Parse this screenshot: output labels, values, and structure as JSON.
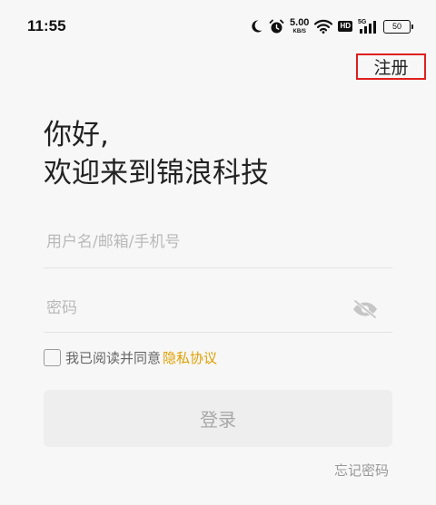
{
  "status_bar": {
    "time": "11:55",
    "net_speed_value": "5.00",
    "net_speed_unit": "KB/S",
    "hd_label": "HD",
    "network_type": "5G",
    "battery_level": "50",
    "icons": [
      "moon-icon",
      "alarm-icon",
      "wifi-icon",
      "signal-icon",
      "battery-icon"
    ]
  },
  "header": {
    "register_label": "注册"
  },
  "greeting": {
    "line1": "你好,",
    "line2": "欢迎来到锦浪科技"
  },
  "form": {
    "username_placeholder": "用户名/邮箱/手机号",
    "username_value": "",
    "password_placeholder": "密码",
    "password_value": "",
    "agree_prefix": "我已阅读并同意",
    "privacy_label": "隐私协议",
    "agree_checked": false,
    "login_label": "登录",
    "forgot_label": "忘记密码"
  },
  "colors": {
    "accent_link": "#e0a000",
    "highlight_border": "#e01e1e",
    "background": "#f7f7f7",
    "button_disabled_bg": "#eeeeee"
  }
}
